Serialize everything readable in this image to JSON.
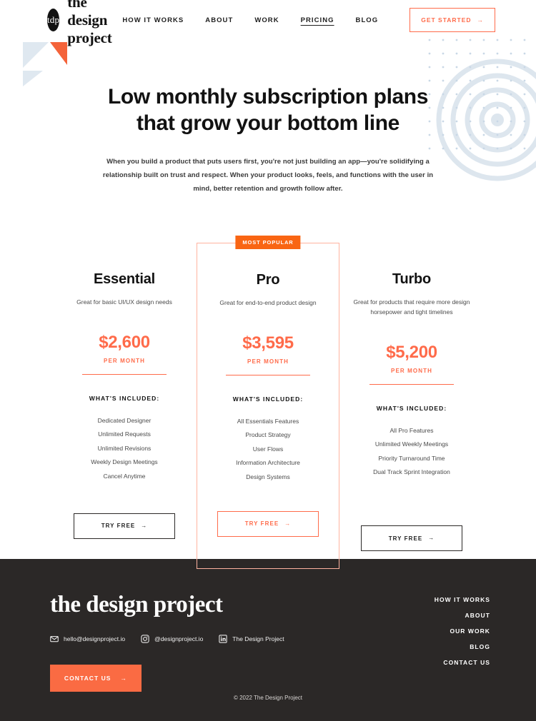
{
  "header": {
    "brand_badge": "tdp",
    "brand_name": "the design project",
    "nav": [
      {
        "label": "HOW IT WORKS",
        "active": false
      },
      {
        "label": "ABOUT",
        "active": false
      },
      {
        "label": "WORK",
        "active": false
      },
      {
        "label": "PRICING",
        "active": true
      },
      {
        "label": "BLOG",
        "active": false
      }
    ],
    "cta_label": "GET STARTED",
    "cta_arrow": "→"
  },
  "hero": {
    "heading_line1": "Low monthly subscription plans",
    "heading_line2": "that grow your bottom line",
    "paragraph": "When you build a product that puts users first, you're not just building an app—you're solidifying a relationship built on trust and respect. When your product looks, feels, and functions with the user in mind, better retention and growth follow after."
  },
  "pricing": {
    "badge_label": "MOST POPULAR",
    "included_title": "WHAT'S INCLUDED:",
    "per_month_label": "PER MONTH",
    "try_label": "TRY FREE",
    "try_arrow": "→",
    "plans": [
      {
        "name": "Essential",
        "desc": "Great for basic UI/UX design needs",
        "price": "$2,600",
        "featured": false,
        "features": [
          "Dedicated Designer",
          "Unlimited Requests",
          "Unlimited Revisions",
          "Weekly Design Meetings",
          "Cancel Anytime"
        ]
      },
      {
        "name": "Pro",
        "desc": "Great for end-to-end product design",
        "price": "$3,595",
        "featured": true,
        "features": [
          "All Essentials Features",
          "Product Strategy",
          "User Flows",
          "Information Architecture",
          "Design Systems"
        ]
      },
      {
        "name": "Turbo",
        "desc": "Great for products that require more design horsepower and tight timelines",
        "price": "$5,200",
        "featured": false,
        "features": [
          "All Pro Features",
          "Unlimited Weekly Meetings",
          "Priority Turnaround Time",
          "Dual Track Sprint Integration"
        ]
      }
    ]
  },
  "footer": {
    "logo": "the design project",
    "contacts": [
      {
        "icon": "email-icon",
        "label": "hello@designproject.io"
      },
      {
        "icon": "instagram-icon",
        "label": "@designproject.io"
      },
      {
        "icon": "linkedin-icon",
        "label": "The Design Project"
      }
    ],
    "contact_button": "CONTACT US",
    "contact_arrow": "→",
    "nav": [
      "HOW IT WORKS",
      "ABOUT",
      "OUR WORK",
      "BLOG",
      "CONTACT US"
    ],
    "copyright": "© 2022 The Design Project"
  },
  "colors": {
    "accent": "#ff6b4a",
    "badge": "#f96513",
    "footer_bg": "#2b2827",
    "deco_blue": "#dde6ee",
    "deco_orange": "#f4633a"
  }
}
